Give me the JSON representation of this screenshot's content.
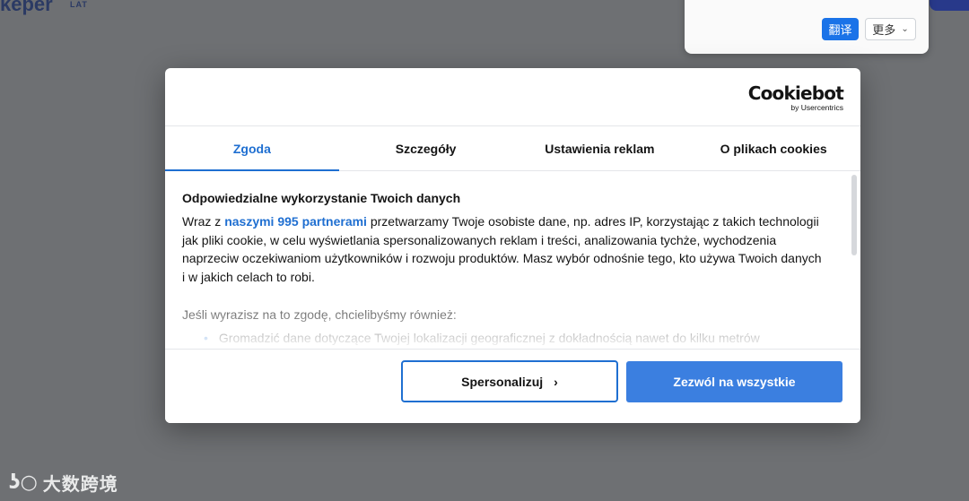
{
  "background": {
    "logo_text": "keper",
    "logo_sub": "LAT"
  },
  "translate_popup": {
    "translate_label": "翻译",
    "more_label": "更多"
  },
  "dialog": {
    "brand": {
      "name": "Cookiebot",
      "byline": "by Usercentrics"
    },
    "tabs": [
      {
        "label": "Zgoda",
        "active": true
      },
      {
        "label": "Szczegóły",
        "active": false
      },
      {
        "label": "Ustawienia reklam",
        "active": false
      },
      {
        "label": "O plikach cookies",
        "active": false
      }
    ],
    "heading": "Odpowiedzialne wykorzystanie Twoich danych",
    "intro_prefix": "Wraz z ",
    "partners_link": "naszymi 995 partnerami",
    "intro_rest": " przetwarzamy Twoje osobiste dane, np. adres IP, korzystając z takich technologii jak pliki cookie, w celu wyświetlania spersonalizowanych reklam i treści, analizowania tychże, wychodzenia naprzeciw oczekiwaniom użytkowników i rozwoju produktów. Masz wybór odnośnie tego, kto używa Twoich danych i w jakich celach to robi.",
    "secondary_text": "Jeśli wyrazisz na to zgodę, chcielibyśmy również:",
    "bullets": [
      "Gromadzić dane dotyczące Twojej lokalizacji geograficznej z dokładnością nawet do kilku metrów"
    ],
    "buttons": {
      "personalize": "Spersonalizuj",
      "allow_all": "Zezwól na wszystkie"
    }
  },
  "watermark": "大数跨境",
  "colors": {
    "accent": "#1f6fd1",
    "primary_button": "#3b7fe0",
    "overlay": "#6e7073"
  }
}
